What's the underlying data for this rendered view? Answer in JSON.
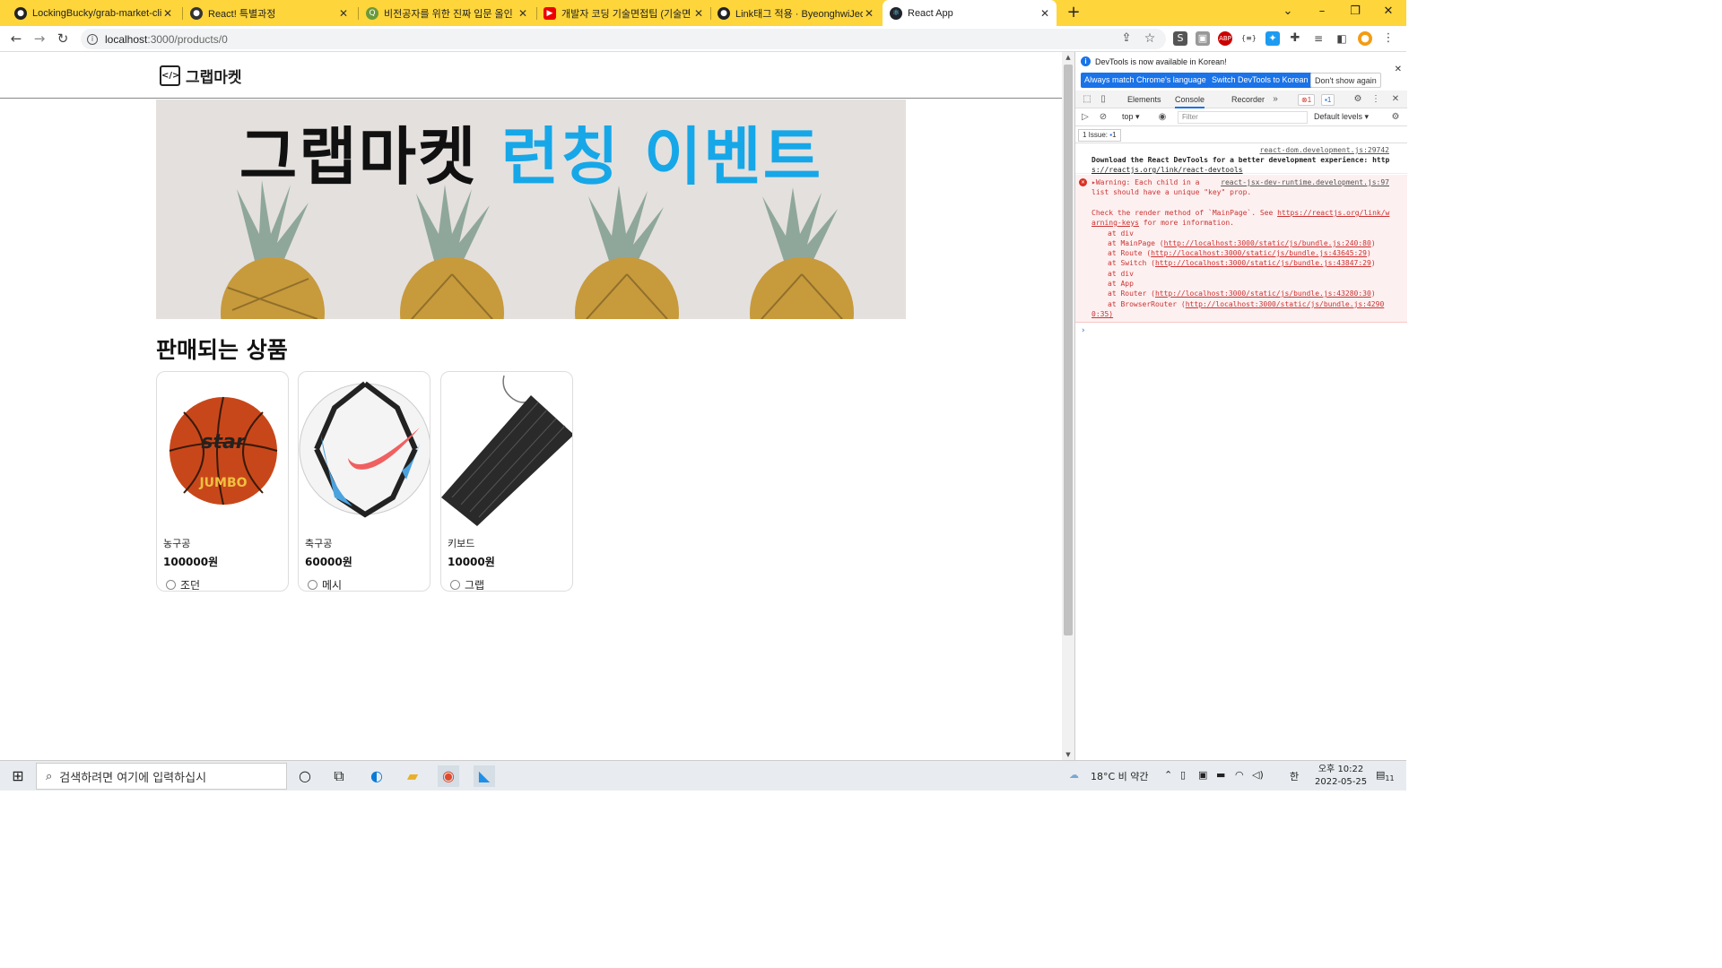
{
  "browser": {
    "tabs": [
      {
        "title": "LockingBucky/grab-market-clier",
        "icon": "github-icon"
      },
      {
        "title": "React! 특별과정",
        "icon": "site-icon"
      },
      {
        "title": "비전공자를 위한 진짜 입문 올인",
        "icon": "search-icon"
      },
      {
        "title": "개발자 코딩 기술면접팁 (기술면",
        "icon": "youtube-icon"
      },
      {
        "title": "Link태그 적용 · ByeonghwiJeong",
        "icon": "github-icon"
      },
      {
        "title": "React App",
        "icon": "react-icon",
        "active": true
      }
    ],
    "url_host": "localhost",
    "url_path": ":3000/products/0",
    "tabbar_color": "#fed53a"
  },
  "page": {
    "logo_text": "그랩마켓",
    "banner_black": "그랩마켓",
    "banner_blue": "런칭 이벤트",
    "section_title": "판매되는 상품",
    "products": [
      {
        "name": "농구공",
        "price": "100000원",
        "seller": "조던",
        "image": "basketball"
      },
      {
        "name": "축구공",
        "price": "60000원",
        "seller": "메시",
        "image": "soccer-ball"
      },
      {
        "name": "키보드",
        "price": "10000원",
        "seller": "그랩",
        "image": "keyboard"
      }
    ]
  },
  "devtools": {
    "banner_msg": "DevTools is now available in Korean!",
    "btn_match": "Always match Chrome's language",
    "btn_switch": "Switch DevTools to Korean",
    "btn_dont": "Don't show again",
    "tabs": [
      "Elements",
      "Console",
      "Recorder"
    ],
    "error_badge": "1",
    "message_badge": "1",
    "context": "top",
    "filter_placeholder": "Filter",
    "levels": "Default levels",
    "issues": "1 Issue:",
    "issues_count": "1",
    "log1_src": "react-dom.development.js:29742",
    "log1_line1": "Download the React DevTools for a better development experience: http",
    "log1_line2": "s://reactjs.org/link/react-devtools",
    "warn_src": "react-jsx-dev-runtime.development.js:97",
    "warn_l1": "▸Warning: Each child in a",
    "warn_l2": "list should have a unique \"key\" prop.",
    "warn_l3": "Check the render method of `MainPage`. See ",
    "warn_l3_link": "https://reactjs.org/link/w",
    "warn_l4_link": "arning-keys",
    "warn_l4": " for more information.",
    "stack": [
      {
        "pre": "at div",
        "link": "",
        "post": ""
      },
      {
        "pre": "at MainPage (",
        "link": "http://localhost:3000/static/js/bundle.js:240:80",
        "post": ")"
      },
      {
        "pre": "at Route (",
        "link": "http://localhost:3000/static/js/bundle.js:43645:29",
        "post": ")"
      },
      {
        "pre": "at Switch (",
        "link": "http://localhost:3000/static/js/bundle.js:43847:29",
        "post": ")"
      },
      {
        "pre": "at div",
        "link": "",
        "post": ""
      },
      {
        "pre": "at App",
        "link": "",
        "post": ""
      },
      {
        "pre": "at Router (",
        "link": "http://localhost:3000/static/js/bundle.js:43280:30",
        "post": ")"
      },
      {
        "pre": "at BrowserRouter (",
        "link": "http://localhost:3000/static/js/bundle.js:4290",
        "post": ""
      }
    ],
    "stack_last": "0:35)"
  },
  "taskbar": {
    "search_placeholder": "검색하려면 여기에 입력하십시",
    "weather": "18°C 비 약간",
    "ime": "한",
    "time": "오후 10:22",
    "date": "2022-05-25",
    "notif": "11"
  }
}
